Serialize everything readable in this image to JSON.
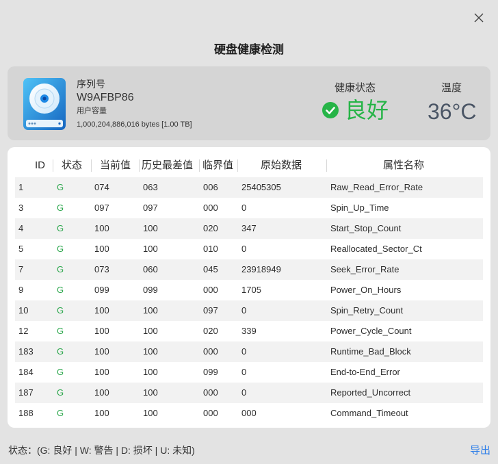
{
  "dialog": {
    "title": "硬盘健康检测",
    "close_icon": "close-icon"
  },
  "disk": {
    "icon": "hard-disk-icon",
    "serial_label": "序列号",
    "serial_value": "W9AFBP86",
    "capacity_label": "用户容量",
    "capacity_value": "1,000,204,886,016 bytes [1.00 TB]"
  },
  "health": {
    "label": "健康状态",
    "value": "良好",
    "icon": "check-circle-icon",
    "color": "#26b447"
  },
  "temperature": {
    "label": "温度",
    "value": "36°C"
  },
  "table": {
    "headers": {
      "id": "ID",
      "status": "状态",
      "current": "当前值",
      "worst": "历史最差值",
      "threshold": "临界值",
      "raw": "原始数据",
      "name": "属性名称"
    },
    "rows": [
      {
        "id": "1",
        "status": "G",
        "current": "074",
        "worst": "063",
        "threshold": "006",
        "raw": "25405305",
        "name": "Raw_Read_Error_Rate"
      },
      {
        "id": "3",
        "status": "G",
        "current": "097",
        "worst": "097",
        "threshold": "000",
        "raw": "0",
        "name": "Spin_Up_Time"
      },
      {
        "id": "4",
        "status": "G",
        "current": "100",
        "worst": "100",
        "threshold": "020",
        "raw": "347",
        "name": "Start_Stop_Count"
      },
      {
        "id": "5",
        "status": "G",
        "current": "100",
        "worst": "100",
        "threshold": "010",
        "raw": "0",
        "name": "Reallocated_Sector_Ct"
      },
      {
        "id": "7",
        "status": "G",
        "current": "073",
        "worst": "060",
        "threshold": "045",
        "raw": "23918949",
        "name": "Seek_Error_Rate"
      },
      {
        "id": "9",
        "status": "G",
        "current": "099",
        "worst": "099",
        "threshold": "000",
        "raw": "1705",
        "name": "Power_On_Hours"
      },
      {
        "id": "10",
        "status": "G",
        "current": "100",
        "worst": "100",
        "threshold": "097",
        "raw": "0",
        "name": "Spin_Retry_Count"
      },
      {
        "id": "12",
        "status": "G",
        "current": "100",
        "worst": "100",
        "threshold": "020",
        "raw": "339",
        "name": "Power_Cycle_Count"
      },
      {
        "id": "183",
        "status": "G",
        "current": "100",
        "worst": "100",
        "threshold": "000",
        "raw": "0",
        "name": "Runtime_Bad_Block"
      },
      {
        "id": "184",
        "status": "G",
        "current": "100",
        "worst": "100",
        "threshold": "099",
        "raw": "0",
        "name": "End-to-End_Error"
      },
      {
        "id": "187",
        "status": "G",
        "current": "100",
        "worst": "100",
        "threshold": "000",
        "raw": "0",
        "name": "Reported_Uncorrect"
      },
      {
        "id": "188",
        "status": "G",
        "current": "100",
        "worst": "100",
        "threshold": "000",
        "raw": "000",
        "name": "Command_Timeout"
      }
    ]
  },
  "footer": {
    "status_legend": "状态：(G: 良好 | W: 警告 | D: 损坏 | U: 未知)",
    "export_label": "导出"
  },
  "colors": {
    "status_good": "#2fa84f",
    "link": "#2b7de9"
  }
}
